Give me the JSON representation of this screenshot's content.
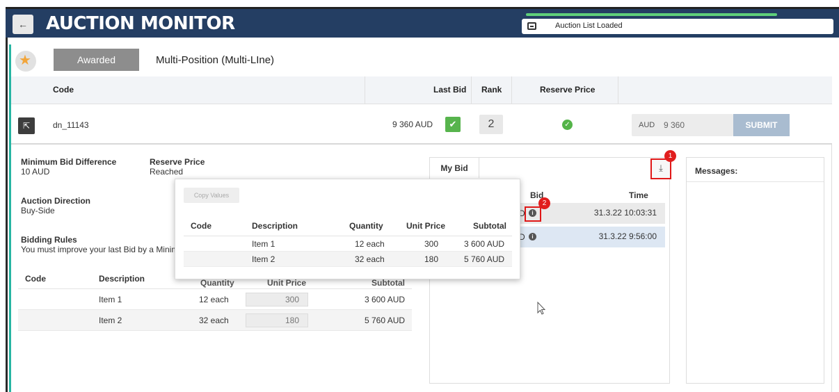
{
  "header": {
    "back_icon": "arrow-left-icon",
    "title": "AUCTION MONITOR",
    "status_progress": 0.82,
    "status_icon": "inbox-icon",
    "status_text": "Auction List Loaded"
  },
  "auction": {
    "star_icon": "star-icon",
    "status_badge": "Awarded",
    "type": "Multi-Position (Multi-LIne)",
    "columns": {
      "code": "Code",
      "last_bid": "Last Bid",
      "rank": "Rank",
      "reserve_price": "Reserve Price"
    },
    "row": {
      "expand_icon": "expand-arrow-icon",
      "code": "dn_11143",
      "last_bid": "9 360 AUD",
      "last_bid_ok_icon": "checkmark-icon",
      "rank": "2",
      "reserve_icon": "check-circle-icon",
      "bid_currency": "AUD",
      "bid_value": "9 360",
      "submit_label": "SUBMIT"
    }
  },
  "details": {
    "min_bid_diff_label": "Minimum Bid Difference",
    "min_bid_diff_value": "10 AUD",
    "reserve_label": "Reserve Price",
    "reserve_value": "Reached",
    "direction_label": "Auction Direction",
    "direction_value": "Buy-Side",
    "rules_label": "Bidding Rules",
    "rules_value": "You must improve your last Bid by a Minim",
    "items_table": {
      "headers": [
        "Code",
        "Description",
        "Quantity",
        "Unit Price",
        "Subtotal"
      ],
      "rows": [
        {
          "code": "",
          "description": "Item 1",
          "quantity": "12 each",
          "unit_price": "300",
          "subtotal": "3 600 AUD"
        },
        {
          "code": "",
          "description": "Item 2",
          "quantity": "32 each",
          "unit_price": "180",
          "subtotal": "5 760 AUD"
        }
      ]
    }
  },
  "my_bid": {
    "tab_label": "My Bid",
    "download_icon": "download-icon",
    "badge_1": "1",
    "badge_2": "2",
    "columns": {
      "bid": "Bid",
      "time": "Time"
    },
    "rows": [
      {
        "bid_fragment": "D",
        "info_icon": "info-icon",
        "time": "31.3.22 10:03:31"
      },
      {
        "bid_fragment": "D",
        "info_icon": "info-icon",
        "time": "31.3.22 9:56:00"
      }
    ]
  },
  "messages": {
    "title": "Messages:"
  },
  "popup": {
    "copy_label": "Copy Values",
    "headers": [
      "Code",
      "Description",
      "Quantity",
      "Unit Price",
      "Subtotal"
    ],
    "rows": [
      {
        "code": "",
        "description": "Item 1",
        "quantity": "12 each",
        "unit_price": "300",
        "subtotal": "3 600 AUD"
      },
      {
        "code": "",
        "description": "Item 2",
        "quantity": "32 each",
        "unit_price": "180",
        "subtotal": "5 760 AUD"
      }
    ]
  },
  "cursor_icon": "mouse-pointer-icon"
}
